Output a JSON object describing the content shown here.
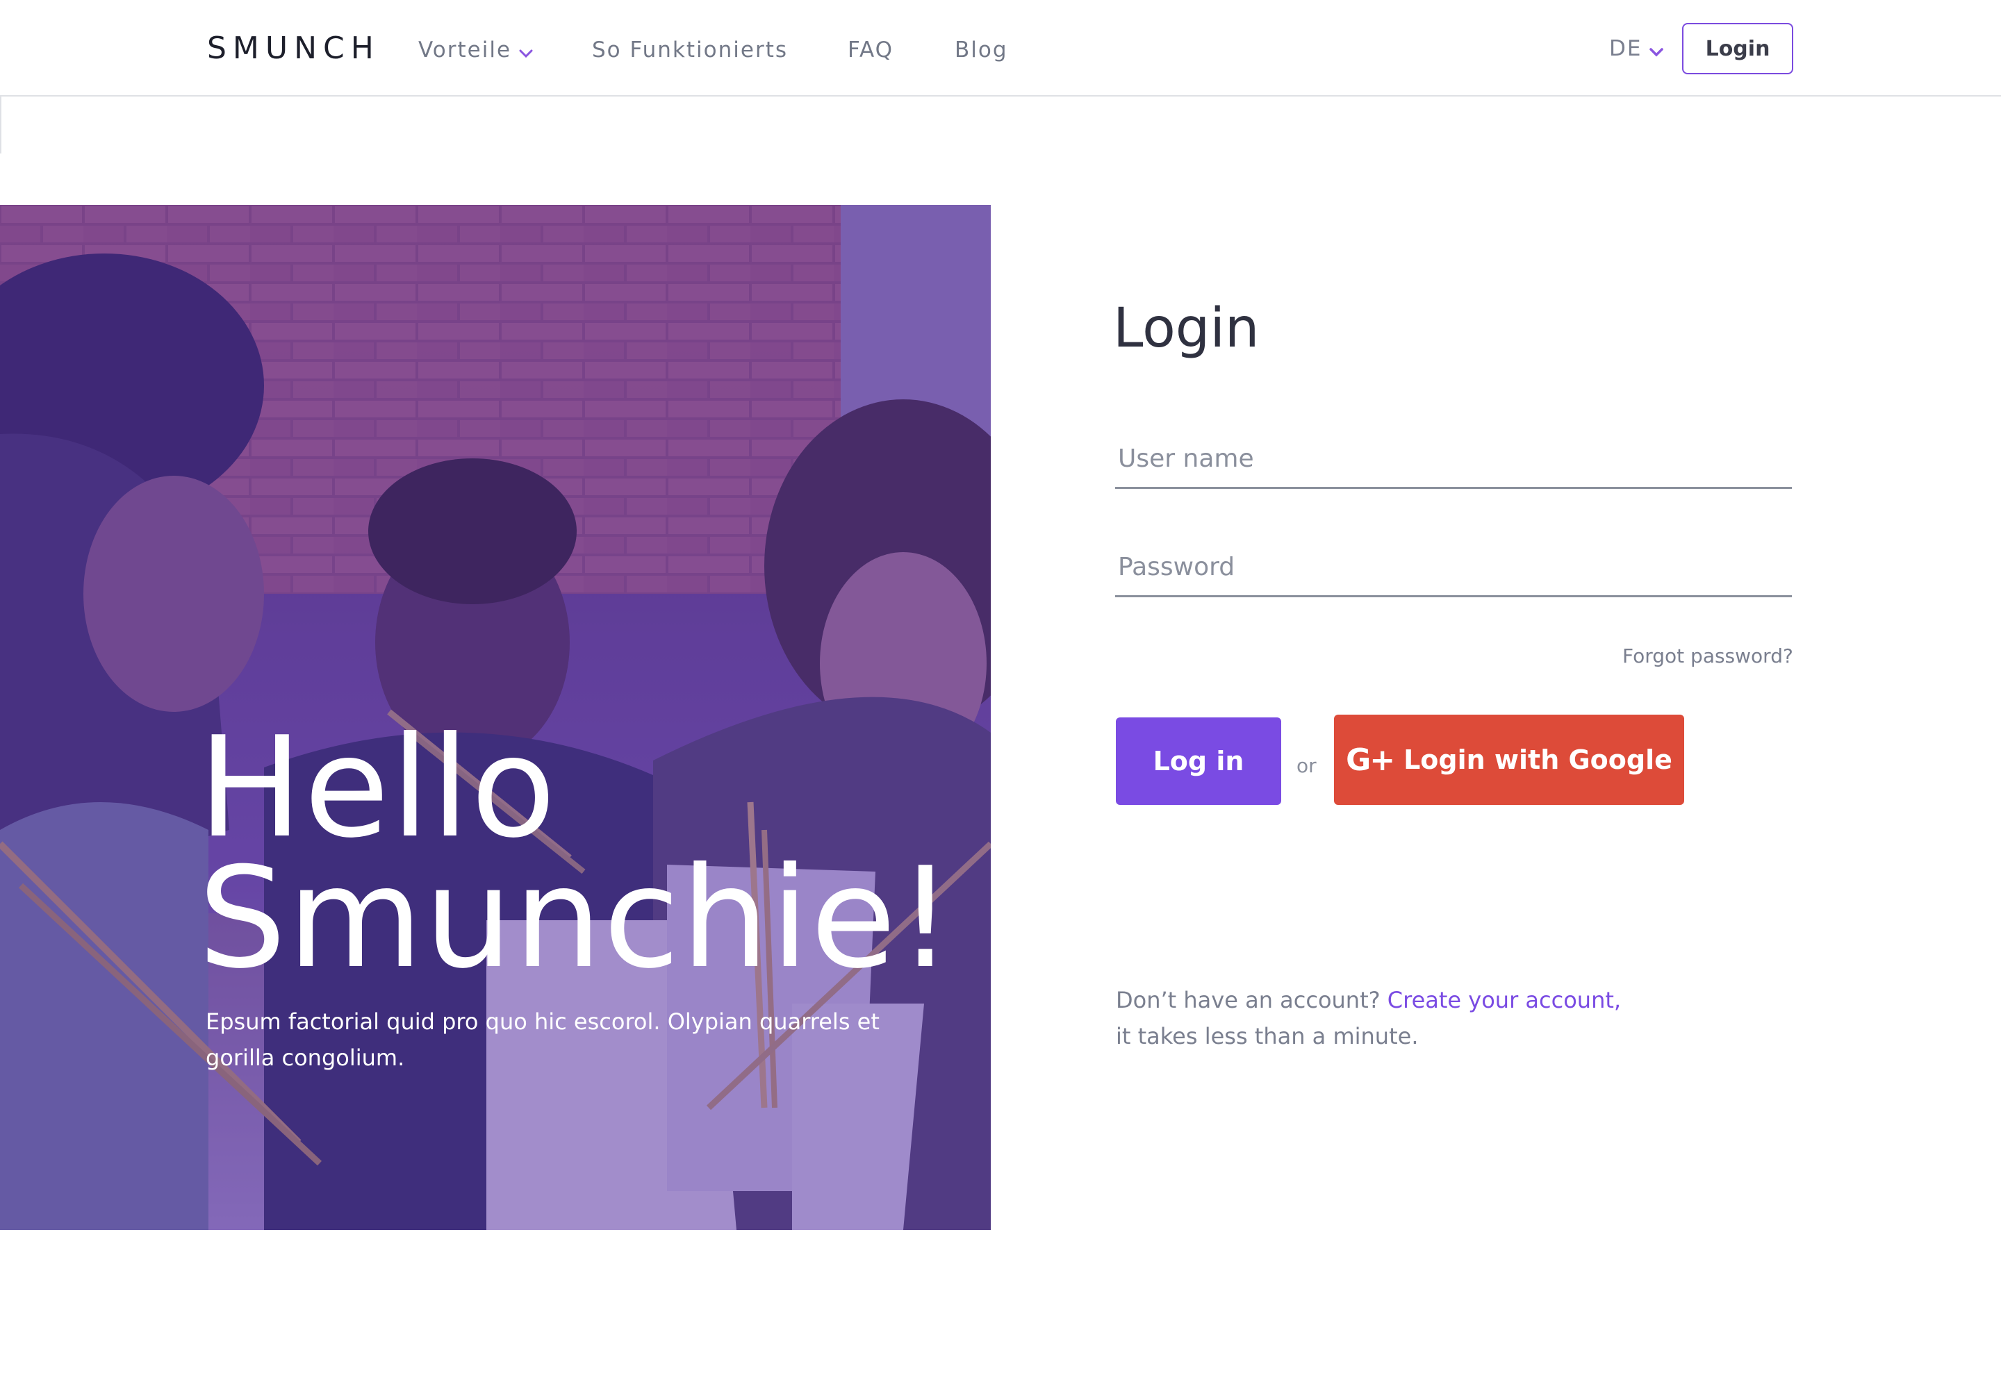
{
  "header": {
    "logo": "SMUNCH",
    "nav": {
      "vorteile": "Vorteile",
      "so_funktionierts": "So Funktionierts",
      "faq": "FAQ",
      "blog": "Blog"
    },
    "language": "DE",
    "login_button": "Login"
  },
  "hero": {
    "title_line1": "Hello",
    "title_line2": "Smunchie!",
    "subtitle": "Epsum factorial quid pro quo hic escorol. Olypian quarrels et gorilla congolium."
  },
  "login": {
    "title": "Login",
    "username_placeholder": "User name",
    "password_placeholder": "Password",
    "forgot_password": "Forgot password?",
    "login_button": "Log in",
    "or": "or",
    "google_button": "Login with Google",
    "google_icon": "G+",
    "no_account": "Don’t have an account?",
    "create_account": "Create your account,",
    "takes_time": "it takes less than a minute."
  },
  "colors": {
    "accent": "#7a4be3",
    "google": "#dd4b39",
    "hero_overlay": "#5e3c90"
  }
}
